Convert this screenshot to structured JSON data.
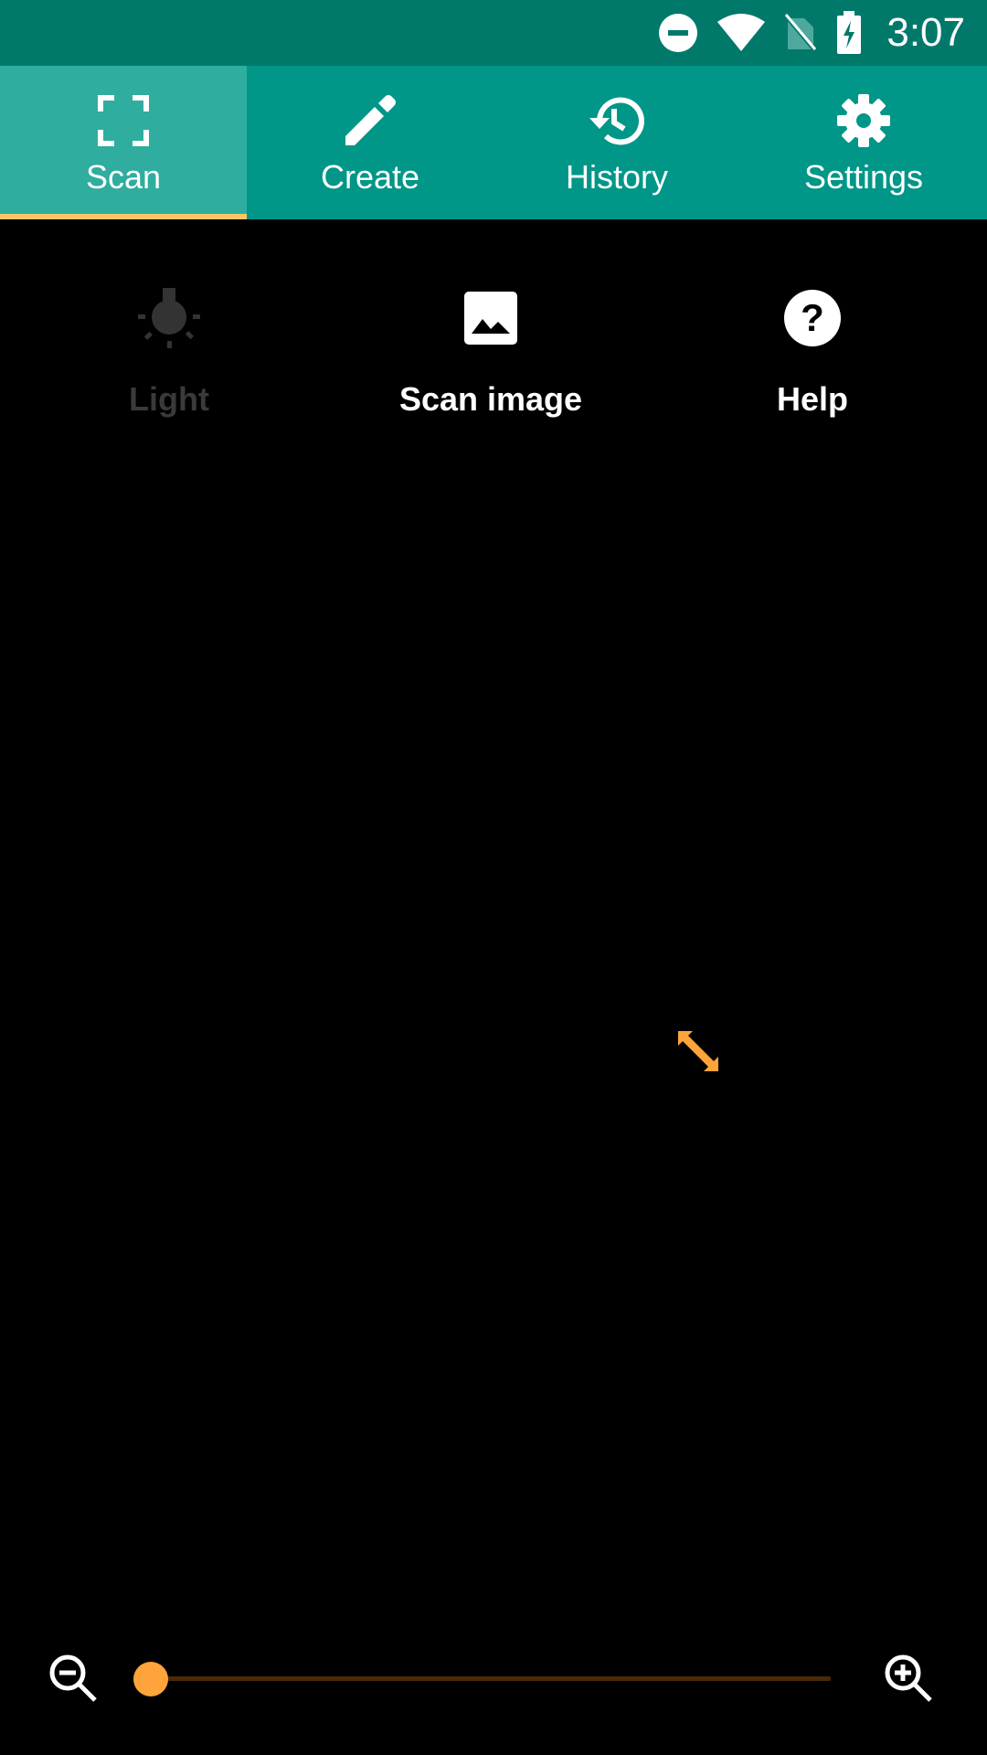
{
  "status_bar": {
    "time": "3:07",
    "icons": [
      "do-not-disturb-icon",
      "wifi-icon",
      "no-sim-icon",
      "battery-charging-icon"
    ],
    "background": "#00796B"
  },
  "tabs": [
    {
      "label": "Scan",
      "icon": "scan-frame-icon",
      "active": true
    },
    {
      "label": "Create",
      "icon": "pencil-icon",
      "active": false
    },
    {
      "label": "History",
      "icon": "history-icon",
      "active": false
    },
    {
      "label": "Settings",
      "icon": "gear-icon",
      "active": false
    }
  ],
  "tab_bar_color": "#009688",
  "tab_active_color": "#2FAD9F",
  "tab_indicator_color": "#FFC666",
  "actions": [
    {
      "label": "Light",
      "icon": "flashlight-icon",
      "enabled": false
    },
    {
      "label": "Scan image",
      "icon": "image-icon",
      "enabled": true
    },
    {
      "label": "Help",
      "icon": "help-icon",
      "enabled": true
    }
  ],
  "viewfinder": {
    "resize_handle_icon": "resize-diagonal-icon",
    "accent": "#FFA43A"
  },
  "zoom": {
    "level": 0.0,
    "zoom_out_icon": "zoom-out-icon",
    "zoom_in_icon": "zoom-in-icon"
  }
}
